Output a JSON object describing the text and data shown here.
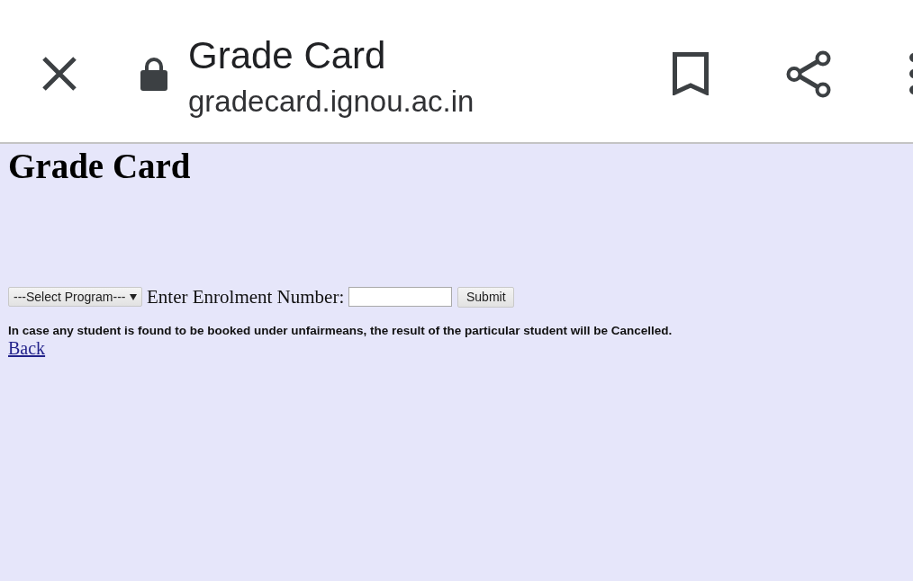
{
  "toolbar": {
    "title": "Grade Card",
    "url": "gradecard.ignou.ac.in"
  },
  "page": {
    "heading": "Grade Card",
    "form": {
      "program_select": {
        "value": "---Select Program---"
      },
      "enrolment_label": "Enter Enrolment Number:",
      "submit_button": "Submit"
    },
    "notice": "In case any student is found to be booked under unfairmeans, the result of the particular student will be Cancelled.",
    "back_link": "Back"
  }
}
